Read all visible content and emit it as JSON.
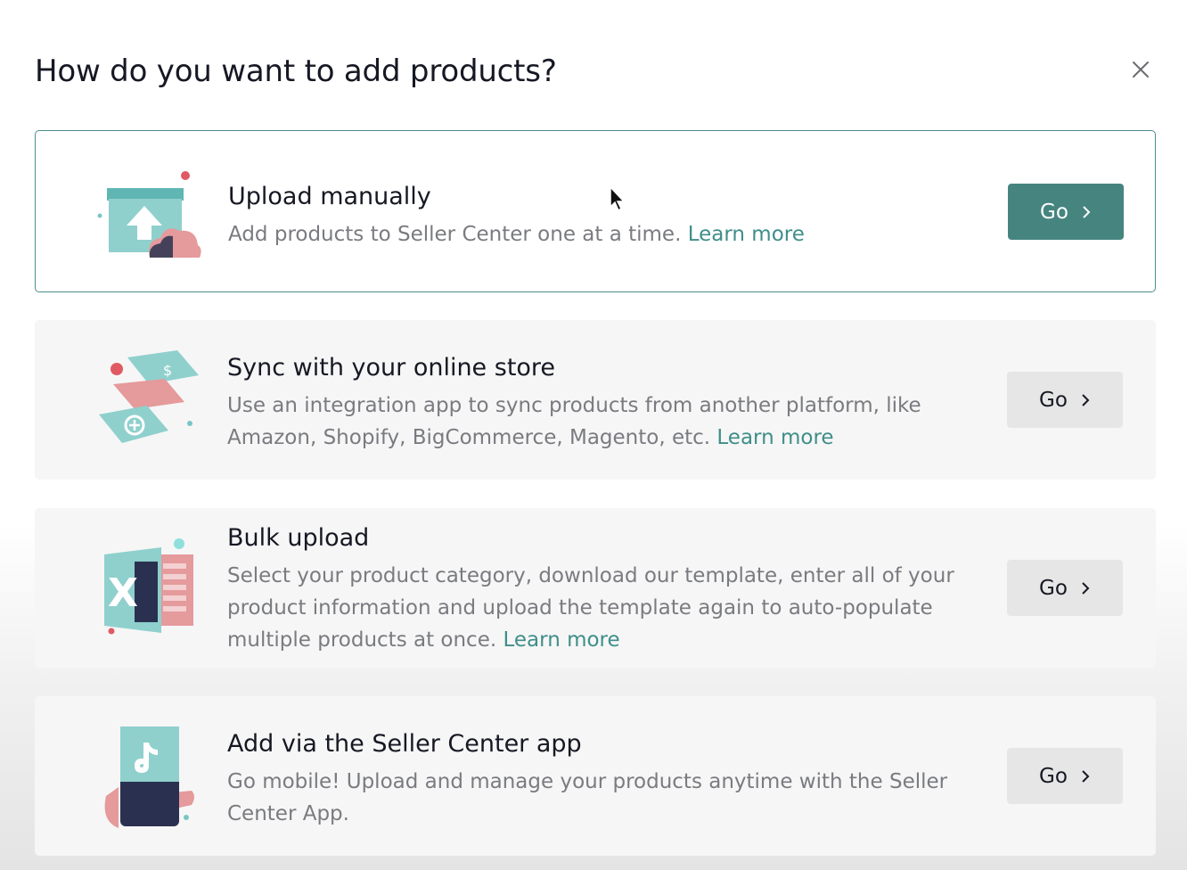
{
  "dialog": {
    "title": "How do you want to add products?",
    "close_icon": "close-icon"
  },
  "options": [
    {
      "title": "Upload manually",
      "description": "Add products to Seller Center one at a time.",
      "learn_more": "Learn more",
      "button": "Go",
      "selected": true,
      "icon": "upload-box-icon"
    },
    {
      "title": "Sync with your online store",
      "description": "Use an integration app to sync products from another platform, like Amazon, Shopify, BigCommerce, Magento, etc.",
      "learn_more": "Learn more",
      "button": "Go",
      "selected": false,
      "icon": "sync-store-icon"
    },
    {
      "title": "Bulk upload",
      "description": "Select your product category, download our template, enter all of your product information and upload the template again to auto-populate multiple products at once.",
      "learn_more": "Learn more",
      "button": "Go",
      "selected": false,
      "icon": "spreadsheet-icon"
    },
    {
      "title": "Add via the Seller Center app",
      "description": "Go mobile! Upload and manage your products anytime with the Seller Center App.",
      "button": "Go",
      "selected": false,
      "icon": "mobile-app-icon"
    }
  ],
  "colors": {
    "accent": "#46857f",
    "link": "#3f8e89",
    "teal_illustration": "#79c6c3",
    "pink_illustration": "#e59a9c",
    "navy_illustration": "#2a3150"
  }
}
